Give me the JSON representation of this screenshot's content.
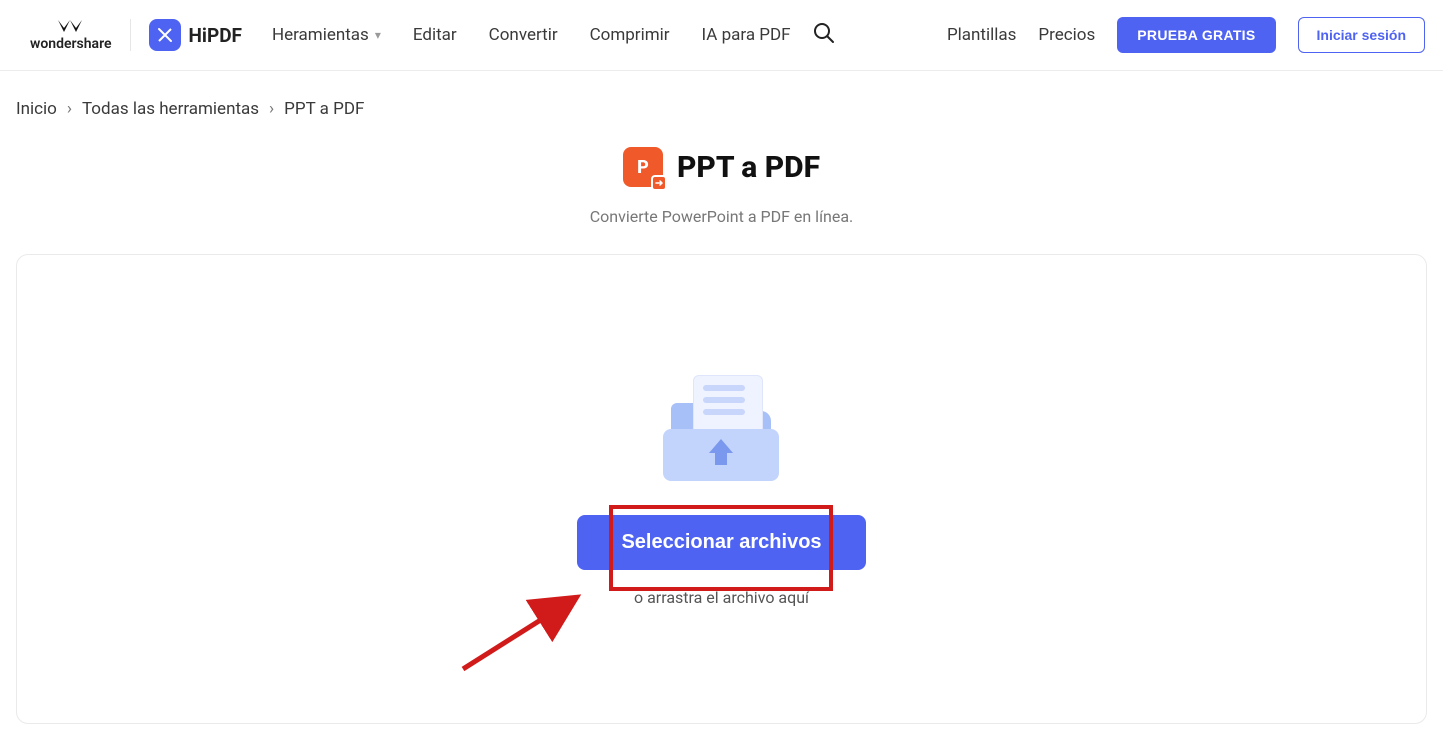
{
  "brand": {
    "wondershare": "wondershare",
    "hipdf": "HiPDF"
  },
  "nav": {
    "tools": "Heramientas",
    "edit": "Editar",
    "convert": "Convertir",
    "compress": "Comprimir",
    "ai": "IA para PDF"
  },
  "right": {
    "templates": "Plantillas",
    "pricing": "Precios",
    "trial": "PRUEBA GRATIS",
    "login": "Iniciar sesión"
  },
  "breadcrumb": {
    "home": "Inicio",
    "all_tools": "Todas las herramientas",
    "current": "PPT a PDF"
  },
  "page": {
    "title": "PPT a PDF",
    "subtitle": "Convierte PowerPoint a PDF en línea."
  },
  "upload": {
    "select_btn": "Seleccionar archivos",
    "drag_text": "o arrastra el archivo aquí"
  }
}
